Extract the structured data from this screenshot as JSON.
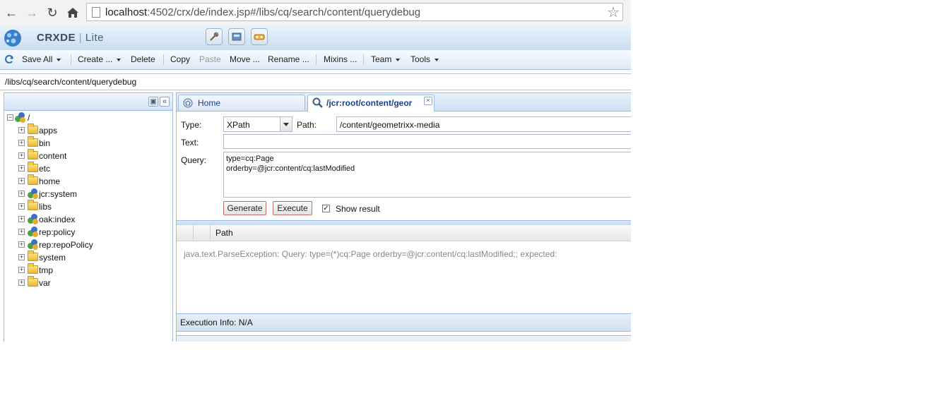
{
  "browser": {
    "url_host": "localhost",
    "url_rest": ":4502/crx/de/index.jsp#/libs/cq/search/content/querydebug"
  },
  "app": {
    "brand_name": "CRXDE",
    "brand_sep": "|",
    "brand_suffix": "Lite"
  },
  "toolbar": {
    "items": [
      {
        "label": "Save All",
        "dropdown": true,
        "disabled": false
      },
      {
        "label": "Create ...",
        "dropdown": true,
        "disabled": false
      },
      {
        "label": "Delete",
        "dropdown": false,
        "disabled": false
      },
      {
        "label": "Copy",
        "dropdown": false,
        "disabled": false
      },
      {
        "label": "Paste",
        "dropdown": false,
        "disabled": true
      },
      {
        "label": "Move ...",
        "dropdown": false,
        "disabled": false
      },
      {
        "label": "Rename ...",
        "dropdown": false,
        "disabled": false
      },
      {
        "label": "Mixins ...",
        "dropdown": false,
        "disabled": false
      },
      {
        "label": "Team",
        "dropdown": true,
        "disabled": false
      },
      {
        "label": "Tools",
        "dropdown": true,
        "disabled": false
      }
    ]
  },
  "path_bar": {
    "value": "/libs/cq/search/content/querydebug"
  },
  "tree": {
    "root_label": "/",
    "nodes": [
      {
        "label": "apps",
        "icon": "folder"
      },
      {
        "label": "bin",
        "icon": "folder"
      },
      {
        "label": "content",
        "icon": "folder"
      },
      {
        "label": "etc",
        "icon": "folder"
      },
      {
        "label": "home",
        "icon": "folder"
      },
      {
        "label": "jcr:system",
        "icon": "node"
      },
      {
        "label": "libs",
        "icon": "folder"
      },
      {
        "label": "oak:index",
        "icon": "node"
      },
      {
        "label": "rep:policy",
        "icon": "node"
      },
      {
        "label": "rep:repoPolicy",
        "icon": "node"
      },
      {
        "label": "system",
        "icon": "folder"
      },
      {
        "label": "tmp",
        "icon": "folder"
      },
      {
        "label": "var",
        "icon": "folder"
      }
    ]
  },
  "tabs": {
    "home": "Home",
    "query": "/jcr:root/content/geor"
  },
  "query_form": {
    "type_label": "Type:",
    "type_value": "XPath",
    "path_label": "Path:",
    "path_value": "/content/geometrixx-media",
    "text_label": "Text:",
    "text_value": "",
    "query_label": "Query:",
    "query_lines": [
      "type=cq:Page",
      "orderby=@jcr:content/cq:lastModified"
    ],
    "generate_label": "Generate",
    "execute_label": "Execute",
    "show_result_label": "Show result",
    "show_result_checked": true
  },
  "results": {
    "column_path": "Path",
    "error": "java.text.ParseException: Query: type=(*)cq:Page orderby=@jcr:content/cq:lastModified;; expected:"
  },
  "execution_info": "Execution Info: N/A"
}
